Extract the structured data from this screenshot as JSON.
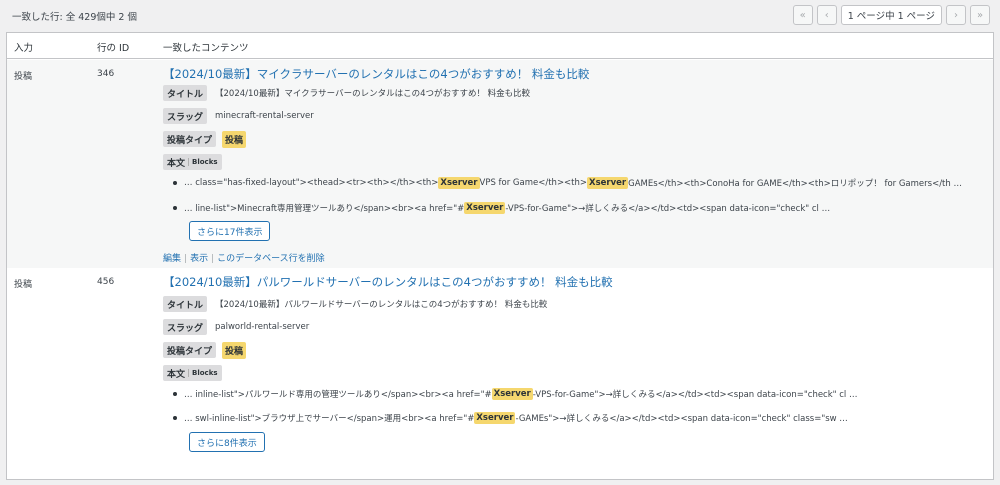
{
  "summary": "一致した行: 全 429個中 2 個",
  "pagination": {
    "first": "«",
    "prev": "‹",
    "page_text": "1 ページ中 1 ページ",
    "next": "›",
    "last": "»"
  },
  "columns": {
    "input": "入力",
    "row_id": "行の ID",
    "content": "一致したコンテンツ"
  },
  "labels": {
    "title": "タイトル",
    "slug": "スラッグ",
    "post_type": "投稿タイプ",
    "body": "本文",
    "blocks": "Blocks"
  },
  "results": [
    {
      "input": "投稿",
      "row_id": "346",
      "link_title": "【2024/10最新】マイクラサーバーのレンタルはこの4つがおすすめ！ 料金も比較",
      "title": "【2024/10最新】マイクラサーバーのレンタルはこの4つがおすすめ！ 料金も比較",
      "slug": "minecraft-rental-server",
      "post_type": "投稿",
      "snippets": [
        {
          "a": "… class=\"has-fixed-layout\"><thead><tr><th></th><th>",
          "h1": "Xserver",
          "b": " VPS for Game</th><th>",
          "h2": "Xserver",
          "c": " GAMEs</th><th>ConoHa for GAME</th><th>ロリポップ！ for Gamers</th …"
        },
        {
          "a": "… line-list\">Minecraft専用管理ツールあり</span><br><a href=\"#",
          "h1": "Xserver",
          "b": "-VPS-for-Game\">→詳しくみる</a></td><td><span data-icon=\"check\" cl …",
          "h2": "",
          "c": ""
        }
      ],
      "more": "さらに17件表示",
      "actions": {
        "edit": "編集",
        "view": "表示",
        "delete": "このデータベース行を削除"
      }
    },
    {
      "input": "投稿",
      "row_id": "456",
      "link_title": "【2024/10最新】パルワールドサーバーのレンタルはこの4つがおすすめ！ 料金も比較",
      "title": "【2024/10最新】パルワールドサーバーのレンタルはこの4つがおすすめ！ 料金も比較",
      "slug": "palworld-rental-server",
      "post_type": "投稿",
      "snippets": [
        {
          "a": "… inline-list\">パルワールド専用の管理ツールあり</span><br><a href=\"#",
          "h1": "Xserver",
          "b": "-VPS-for-Game\">→詳しくみる</a></td><td><span data-icon=\"check\" cl …",
          "h2": "",
          "c": ""
        },
        {
          "a": "… swl-inline-list\">ブラウザ上でサーバー</span>運用<br><a href=\"#",
          "h1": "Xserver",
          "b": "-GAMEs\">→詳しくみる</a></td><td><span data-icon=\"check\" class=\"sw …",
          "h2": "",
          "c": ""
        }
      ],
      "more": "さらに8件表示"
    }
  ]
}
